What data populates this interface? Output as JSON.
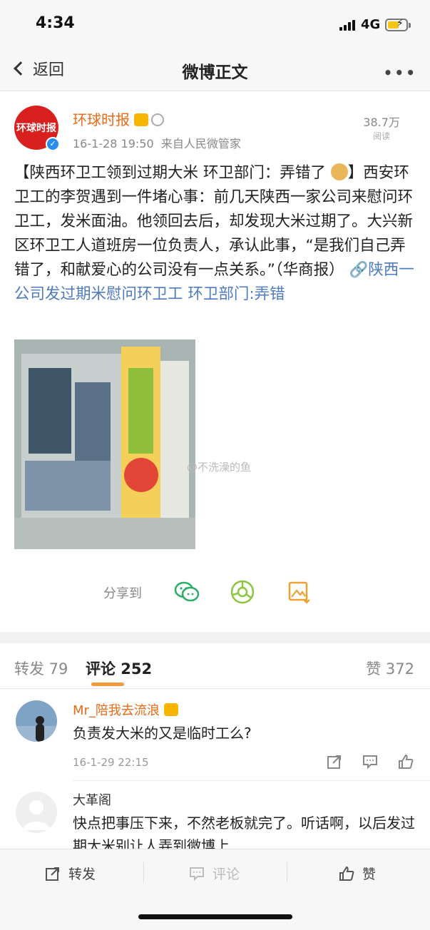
{
  "status_bar": {
    "time": "4:34",
    "network": "4G"
  },
  "nav": {
    "back_label": "返回",
    "title": "微博正文",
    "more": "•••"
  },
  "post": {
    "author": "环球时报",
    "avatar_text": "环球时报",
    "time": "16-1-28 19:50",
    "source": "来自人民微管家",
    "views_count": "38.7万",
    "views_label": "阅读",
    "text_head": "【陕西环卫工领到过期大米 环卫部门：弄错了",
    "text_head_end": "】",
    "text_body": "西安环卫工的李贺遇到一件堵心事：前几天陕西一家公司来慰问环卫工，发米面油。他领回去后，却发现大米过期了。大兴新区环卫工人道班房一位负责人，承认此事，“是我们自己弄错了，和献爱心的公司没有一点关系。”（华商报）",
    "link_text": "陕西一公司发过期米慰问环卫工 环卫部门:弄错",
    "image_watermark": "@不洗澡的鱼"
  },
  "share": {
    "label": "分享到"
  },
  "tabs": {
    "repost": "转发 79",
    "comments": "评论 252",
    "likes": "赞 372"
  },
  "comments": [
    {
      "name": "Mr_陪我去流浪",
      "text": "负责发大米的又是临时工么?",
      "time": "16-1-29 22:15",
      "name_color": "#eb6a16"
    },
    {
      "name": "大革阁",
      "text": "快点把事压下来，不然老板就完了。听话啊，以后发过期大米别让人弄到微博上",
      "time": "",
      "name_color": "#333333"
    }
  ],
  "bottom_bar": {
    "repost": "转发",
    "comment": "评论",
    "like": "赞"
  }
}
